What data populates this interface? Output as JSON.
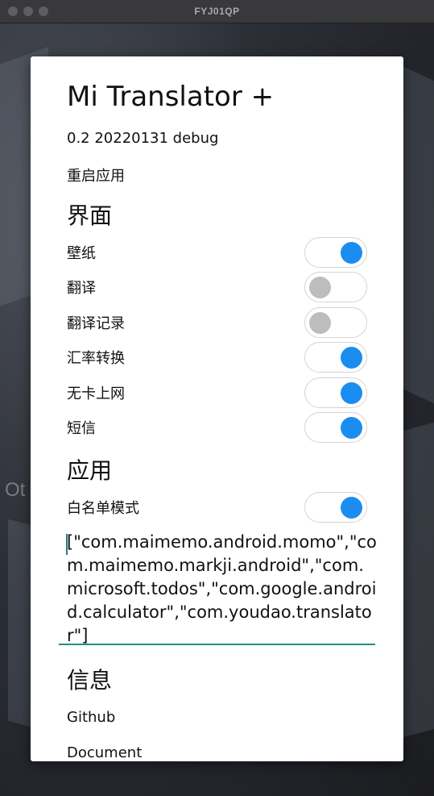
{
  "window": {
    "title": "FYJ01QP"
  },
  "wallpaper": {
    "text": "Ot"
  },
  "dialog": {
    "title": "Mi Translator +",
    "version": "0.2 20220131 debug",
    "restart_label": "重启应用",
    "sections": {
      "interface": "界面",
      "apps": "应用",
      "info": "信息"
    },
    "interface_toggles": [
      {
        "label": "壁纸",
        "on": true
      },
      {
        "label": "翻译",
        "on": false
      },
      {
        "label": "翻译记录",
        "on": false
      },
      {
        "label": "汇率转换",
        "on": true
      },
      {
        "label": "无卡上网",
        "on": true
      },
      {
        "label": "短信",
        "on": true
      }
    ],
    "whitelist_toggle": {
      "label": "白名单模式",
      "on": true
    },
    "whitelist_value": "[\"com.maimemo.android.momo\",\"com.maimemo.markji.android\",\"com.microsoft.todos\",\"com.google.android.calculator\",\"com.youdao.translator\"]",
    "links": {
      "github": "Github",
      "document": "Document"
    }
  },
  "colors": {
    "accent": "#1b8df0",
    "knob_off": "#bdbdbd",
    "input_underline": "#1e8f86"
  }
}
